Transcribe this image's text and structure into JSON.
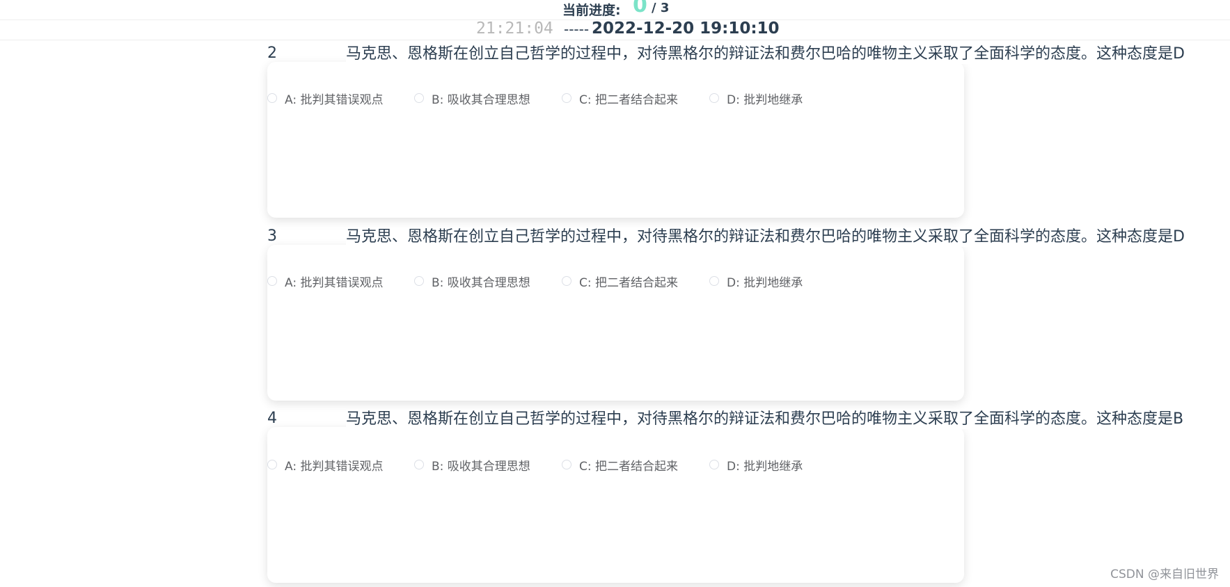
{
  "progress": {
    "label": "当前进度:",
    "current": "0",
    "total": "/ 3"
  },
  "timer": {
    "remaining": "21:21:04",
    "separator": "-----",
    "deadline": "2022-12-20 19:10:10"
  },
  "questions": [
    {
      "number": "2",
      "text": "马克思、恩格斯在创立自己哲学的过程中，对待黑格尔的辩证法和费尔巴哈的唯物主义采取了全面科学的态度。这种态度是D",
      "options": [
        "A: 批判其错误观点",
        "B: 吸收其合理思想",
        "C: 把二者结合起来",
        "D: 批判地继承"
      ]
    },
    {
      "number": "3",
      "text": "马克思、恩格斯在创立自己哲学的过程中，对待黑格尔的辩证法和费尔巴哈的唯物主义采取了全面科学的态度。这种态度是D",
      "options": [
        "A: 批判其错误观点",
        "B: 吸收其合理思想",
        "C: 把二者结合起来",
        "D: 批判地继承"
      ]
    },
    {
      "number": "4",
      "text": "马克思、恩格斯在创立自己哲学的过程中，对待黑格尔的辩证法和费尔巴哈的唯物主义采取了全面科学的态度。这种态度是B",
      "options": [
        "A: 批判其错误观点",
        "B: 吸收其合理思想",
        "C: 把二者结合起来",
        "D: 批判地继承"
      ]
    }
  ],
  "watermark": "CSDN @来自旧世界"
}
